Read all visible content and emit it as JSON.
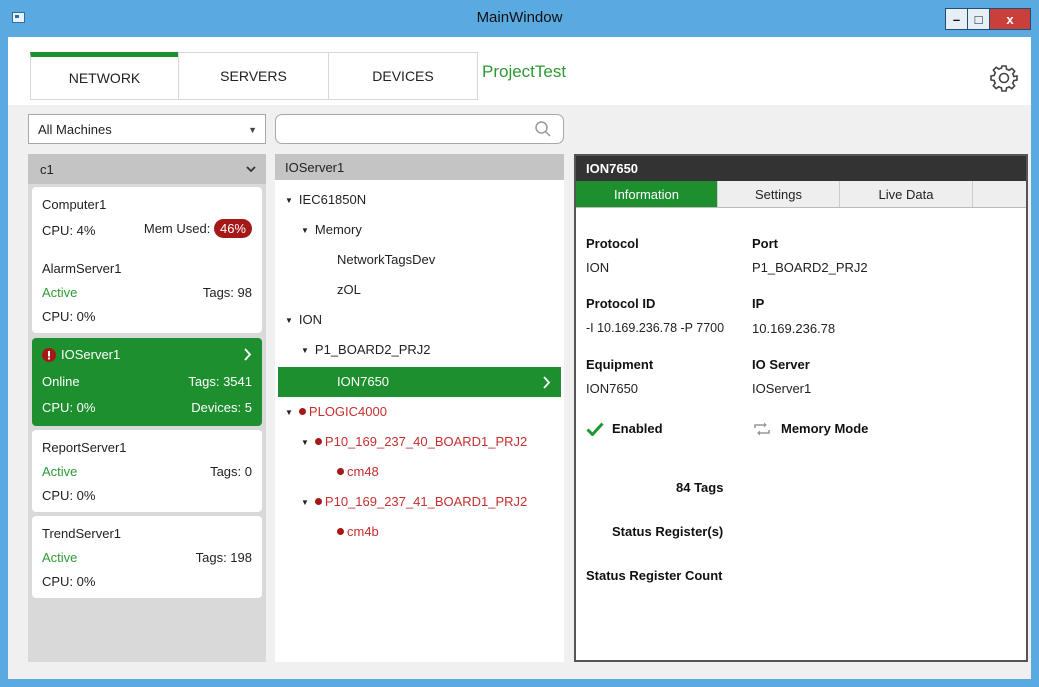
{
  "window": {
    "title": "MainWindow",
    "minimize": "–",
    "maximize": "□",
    "close": "x"
  },
  "tabs": [
    {
      "label": "NETWORK"
    },
    {
      "label": "SERVERS"
    },
    {
      "label": "DEVICES"
    }
  ],
  "project": "ProjectTest",
  "machine_filter": {
    "selected": "All Machines"
  },
  "search": {
    "placeholder": ""
  },
  "group": {
    "name": "c1"
  },
  "servers": [
    {
      "name": "Computer1",
      "cpu": "CPU:  4%",
      "mem_label": "Mem Used:",
      "mem_value": "46%"
    },
    {
      "name": "AlarmServer1",
      "status": "Active",
      "tags": "Tags: 98",
      "cpu": "CPU:  0%"
    },
    {
      "name": "IOServer1",
      "status": "Online",
      "tags": "Tags: 3541",
      "cpu": "CPU:  0%",
      "devices": "Devices: 5"
    },
    {
      "name": "ReportServer1",
      "status": "Active",
      "tags": "Tags: 0",
      "cpu": "CPU:  0%"
    },
    {
      "name": "TrendServer1",
      "status": "Active",
      "tags": "Tags: 198",
      "cpu": "CPU:  0%"
    }
  ],
  "tree": {
    "header": "IOServer1",
    "nodes": [
      "IEC61850N",
      "Memory",
      "NetworkTagsDev",
      "zOL",
      "ION",
      "P1_BOARD2_PRJ2",
      "ION7650",
      "PLOGIC4000",
      "P10_169_237_40_BOARD1_PRJ2",
      "cm48",
      "P10_169_237_41_BOARD1_PRJ2",
      "cm4b"
    ]
  },
  "detail": {
    "header": "ION7650",
    "tabs": [
      "Information",
      "Settings",
      "Live Data"
    ],
    "protocol_label": "Protocol",
    "protocol": "ION",
    "port_label": "Port",
    "port": "P1_BOARD2_PRJ2",
    "protocol_id_label": "Protocol ID",
    "protocol_id": "-I 10.169.236.78 -P 7700",
    "ip_label": "IP",
    "ip": "10.169.236.78",
    "equipment_label": "Equipment",
    "equipment": "ION7650",
    "io_server_label": "IO Server",
    "io_server": "IOServer1",
    "enabled": "Enabled",
    "memory_mode": "Memory Mode",
    "tags_count": "84 Tags",
    "status_registers": "Status Register(s)",
    "status_register_count": "Status Register Count"
  },
  "colors": {
    "accent": "#1d8f2e",
    "alert": "#a51818",
    "titlebar": "#5aa9e0",
    "error_text": "#c62f2f"
  }
}
